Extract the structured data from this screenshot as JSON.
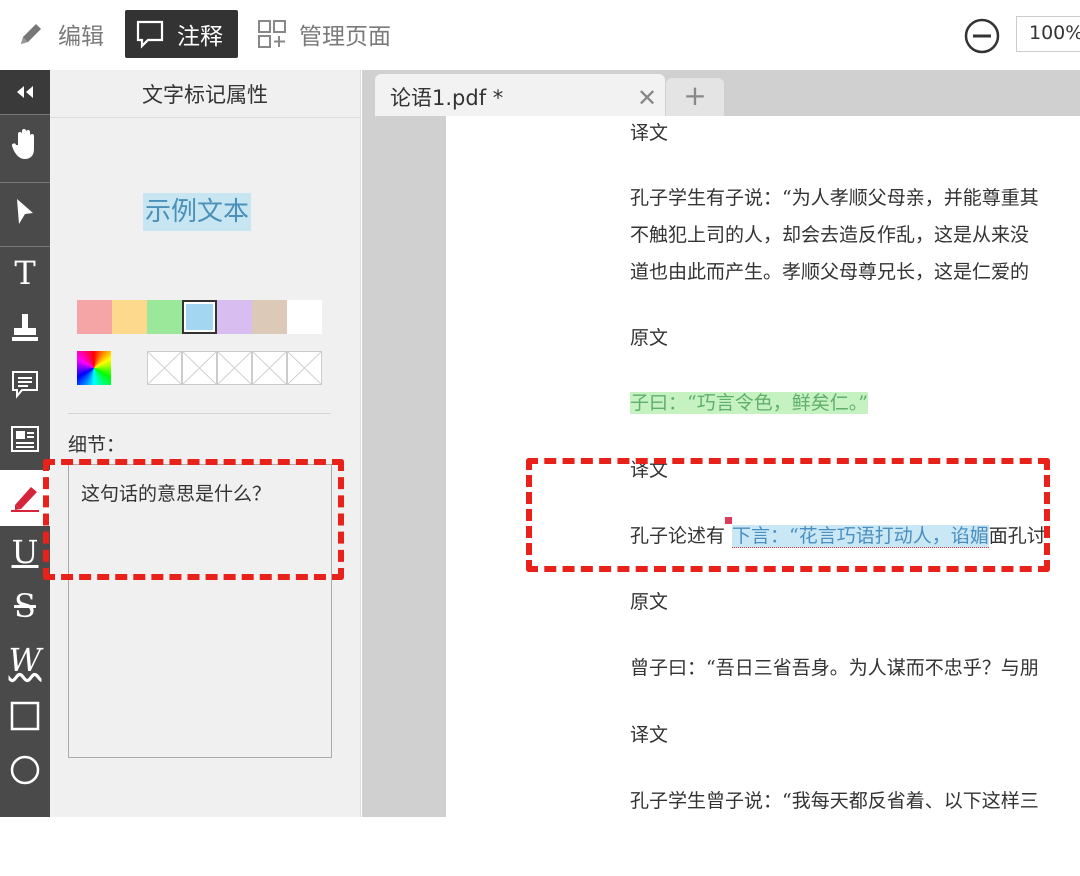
{
  "toolbar": {
    "edit_label": "编辑",
    "annotate_label": "注释",
    "manage_label": "管理页面",
    "zoom": "100%"
  },
  "panel": {
    "title": "文字标记属性",
    "sample_text": "示例文本",
    "swatch_colors": [
      "#f5a5a5",
      "#fcd98c",
      "#9be89b",
      "#a3d6f0",
      "#d8bdf0",
      "#dcc9b8",
      "#ffffff"
    ],
    "selected_swatch": 3,
    "detail_label": "细节：",
    "detail_text": "这句话的意思是什么？"
  },
  "document": {
    "tab_title": "论语1.pdf *",
    "lines": [
      "译文",
      "孔子学生有子说：“为人孝顺父母亲，并能尊重其",
      "不触犯上司的人，却会去造反作乱，这是从来没",
      "道也由此而产生。孝顺父母尊兄长，这是仁爱的",
      "原文",
      "子曰：“巧言令色，鲜矣仁。”",
      "译文",
      "孔子论述有",
      "下言：“花言巧语打动人，谄媚",
      "面孔讨",
      "原文",
      "曾子曰：“吾日三省吾身。为人谋而不忠乎？与朋",
      "译文",
      "孔子学生曾子说：“我每天都反省着、以下这样三"
    ]
  }
}
